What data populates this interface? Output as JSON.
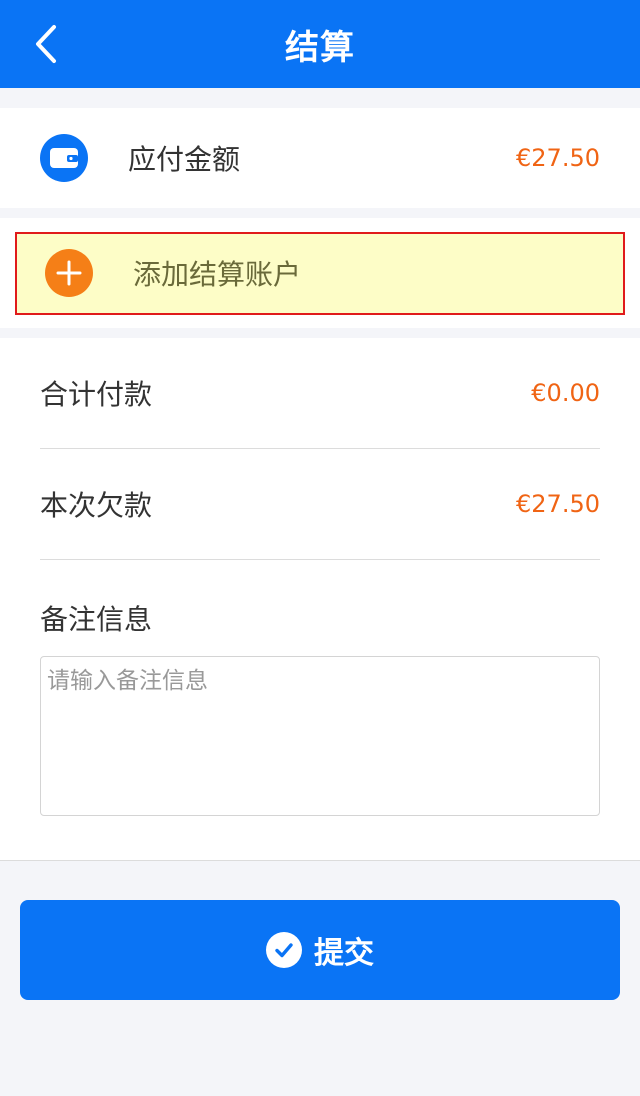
{
  "header": {
    "title": "结算",
    "back_icon": "chevron-left-icon"
  },
  "amount_due": {
    "icon": "wallet-icon",
    "label": "应付金额",
    "value": "€27.50"
  },
  "add_account": {
    "icon": "plus-icon",
    "label": "添加结算账户"
  },
  "details": {
    "total_paid": {
      "label": "合计付款",
      "value": "€0.00"
    },
    "this_debt": {
      "label": "本次欠款",
      "value": "€27.50"
    },
    "remark": {
      "label": "备注信息",
      "placeholder": "请输入备注信息",
      "value": ""
    }
  },
  "submit": {
    "icon": "check-circle-icon",
    "label": "提交"
  },
  "colors": {
    "primary": "#0a74f5",
    "accent_orange": "#f06414",
    "add_circle": "#f57f17",
    "highlight_bg": "#fdfdc7",
    "highlight_border": "#e01b1b"
  }
}
